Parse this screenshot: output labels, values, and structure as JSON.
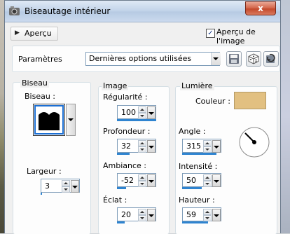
{
  "window": {
    "title": "Biseautage intérieur",
    "close_label": "x"
  },
  "preview": {
    "toggle_label": "Aperçu",
    "checkbox_label": "Aperçu de l'image",
    "checked": true
  },
  "presets": {
    "label": "Paramètres",
    "selected": "Dernières options utilisées"
  },
  "bevel_group": {
    "title": "Biseau",
    "bevel_label": "Biseau :",
    "width_label": "Largeur :",
    "width_value": "3",
    "width_fraction": 0.03
  },
  "image_group": {
    "title": "Image",
    "fields": [
      {
        "label": "Régularité :",
        "value": "100",
        "fraction": 1.0
      },
      {
        "label": "Profondeur :",
        "value": "32",
        "fraction": 0.32
      },
      {
        "label": "Ambiance :",
        "value": "-52",
        "fraction": 0.24
      },
      {
        "label": "Éclat :",
        "value": "20",
        "fraction": 0.2
      }
    ]
  },
  "light_group": {
    "title": "Lumière",
    "color_label": "Couleur :",
    "color": "#e2c081",
    "angle_label": "Angle :",
    "angle_value": "315",
    "angle_fraction": 0.875,
    "intensity_label": "Intensité :",
    "intensity_value": "50",
    "intensity_fraction": 0.5,
    "height_label": "Hauteur :",
    "height_value": "59",
    "height_fraction": 0.66
  },
  "colors": {
    "accent": "#2f84d0",
    "titlebar": "#c4d5ea",
    "close": "#c44a2d"
  }
}
